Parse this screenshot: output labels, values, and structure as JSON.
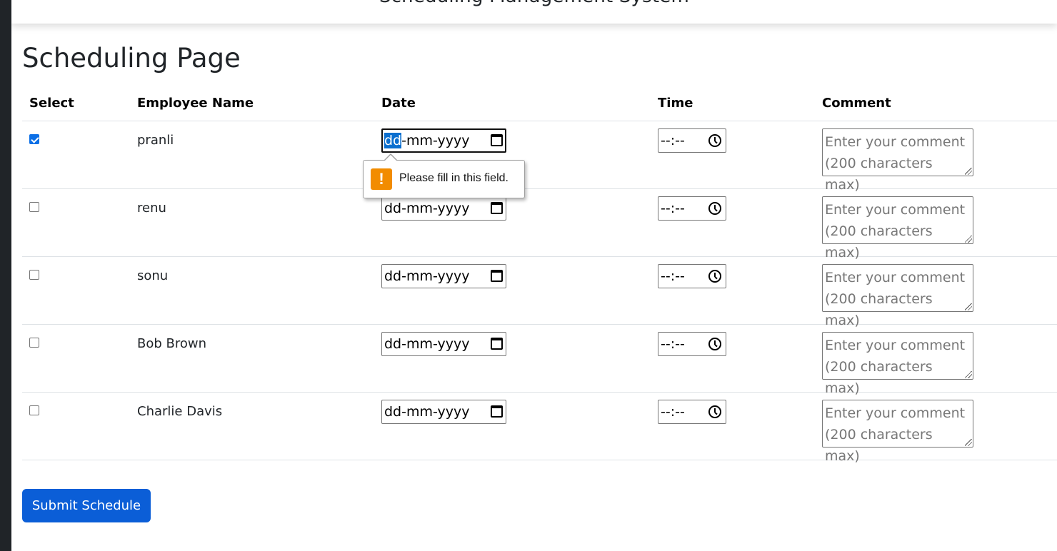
{
  "app": {
    "title": "Scheduling Management System"
  },
  "page": {
    "title": "Scheduling Page"
  },
  "table": {
    "headers": {
      "select": "Select",
      "employee_name": "Employee Name",
      "date": "Date",
      "time": "Time",
      "comment": "Comment"
    },
    "rows": [
      {
        "selected": true,
        "name": "pranli",
        "date_placeholder": "dd-mm-yyyy",
        "date_segment_selected": "dd",
        "date_rest": "-mm-yyyy",
        "time_placeholder": "--:--",
        "comment_placeholder": "Enter your comment (200 characters max)"
      },
      {
        "selected": false,
        "name": "renu",
        "date_placeholder": "dd-mm-yyyy",
        "time_placeholder": "--:--",
        "comment_placeholder": "Enter your comment (200 characters max)"
      },
      {
        "selected": false,
        "name": "sonu",
        "date_placeholder": "dd-mm-yyyy",
        "time_placeholder": "--:--",
        "comment_placeholder": "Enter your comment (200 characters max)"
      },
      {
        "selected": false,
        "name": "Bob Brown",
        "date_placeholder": "dd-mm-yyyy",
        "time_placeholder": "--:--",
        "comment_placeholder": "Enter your comment (200 characters max)"
      },
      {
        "selected": false,
        "name": "Charlie Davis",
        "date_placeholder": "dd-mm-yyyy",
        "time_placeholder": "--:--",
        "comment_placeholder": "Enter your comment (200 characters max)"
      }
    ]
  },
  "validation": {
    "message": "Please fill in this field.",
    "icon": "!",
    "icon_name": "warning-icon",
    "icon_color": "#f28c00"
  },
  "actions": {
    "submit_label": "Submit Schedule",
    "submit_color": "#0b5ed7"
  },
  "colors": {
    "checkbox_checked": "#0b6fe6",
    "selection_highlight": "#0b6fcf"
  }
}
